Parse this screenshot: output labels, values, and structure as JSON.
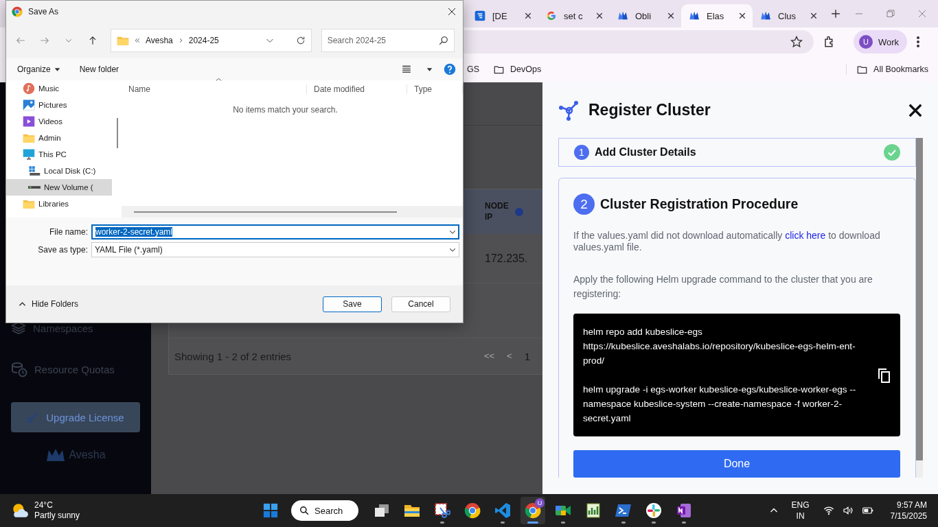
{
  "browser": {
    "tabs": [
      {
        "label": "[DE",
        "kind": "board",
        "selected": false
      },
      {
        "label": "set c",
        "kind": "g",
        "selected": false
      },
      {
        "label": "Obli",
        "kind": "crown",
        "selected": false
      },
      {
        "label": "Elas",
        "kind": "crown",
        "selected": true
      },
      {
        "label": "Clus",
        "kind": "crown",
        "selected": false
      }
    ],
    "profile": {
      "initial": "U",
      "label": "Work"
    },
    "bookmarks": [
      {
        "label": "GS",
        "kind": "plain"
      },
      {
        "label": "DevOps",
        "kind": "folder"
      }
    ],
    "all_bookmarks": "All Bookmarks"
  },
  "app": {
    "sidebar": [
      {
        "label": "Namespaces",
        "kind": "layers"
      },
      {
        "label": "Resource Quotas",
        "kind": "coins"
      }
    ],
    "upgrade_button": "Upgrade License",
    "logo": "Avesha",
    "table": {
      "columns": [
        "NODE IP"
      ],
      "cell": "172.235.",
      "footer": "Showing 1 - 2 of 2 entries",
      "pager": [
        "<<",
        "<",
        "1"
      ]
    }
  },
  "panel": {
    "title": "Register Cluster",
    "step_1": {
      "number": "1",
      "title": "Add Cluster Details",
      "completed": true
    },
    "step_2": {
      "number": "2",
      "title": "Cluster Registration Procedure",
      "intro_before": "If the values.yaml did not download automatically",
      "link": "click here",
      "intro_after": "to download values.yaml file.",
      "instruction": "Apply the following Helm upgrade command to the cluster that you are registering:",
      "commands": [
        "helm repo add kubeslice-egs https://kubeslice.aveshalabs.io/repository/kubeslice-egs-helm-ent-prod/",
        "helm upgrade -i egs-worker kubeslice-egs/kubeslice-worker-egs --namespace kubeslice-system --create-namespace -f worker-2-secret.yaml"
      ],
      "done_button": "Done"
    }
  },
  "dialog": {
    "title": "Save As",
    "path": [
      "Avesha",
      "2024-25"
    ],
    "search": {
      "placeholder": "Search 2024-25"
    },
    "organize": "Organize",
    "new_folder": "New folder",
    "nav": [
      {
        "label": "Music",
        "kind": "music",
        "selected": false
      },
      {
        "label": "Pictures",
        "kind": "pictures",
        "selected": false
      },
      {
        "label": "Videos",
        "kind": "videos",
        "selected": false
      },
      {
        "label": "Admin",
        "kind": "folder",
        "selected": false
      },
      {
        "label": "This PC",
        "kind": "pc",
        "selected": false,
        "children": [
          {
            "label": "Local Disk (C:)",
            "kind": "disk",
            "selected": false
          },
          {
            "label": "New Volume (",
            "kind": "drive",
            "selected": true
          }
        ]
      },
      {
        "label": "Libraries",
        "kind": "folder",
        "selected": false
      }
    ],
    "columns": [
      "Name",
      "Date modified",
      "Type"
    ],
    "empty_message": "No items match your search.",
    "file_name": {
      "label": "File name:",
      "value": "worker-2-secret.yaml"
    },
    "save_type": {
      "label": "Save as type:",
      "value": "YAML File (*.yaml)"
    },
    "hide_folders": "Hide Folders",
    "buttons": [
      "Save",
      "Cancel"
    ]
  },
  "taskbar": {
    "weather": {
      "temp": "24°C",
      "condition": "Partly sunny"
    },
    "search": "Search",
    "apps": [
      {
        "kind": "taskview",
        "running": false,
        "selected": false
      },
      {
        "kind": "explorer",
        "running": false,
        "selected": false
      },
      {
        "kind": "snip",
        "running": true,
        "selected": false
      },
      {
        "kind": "browser",
        "running": false,
        "selected": false
      },
      {
        "kind": "editor",
        "running": true,
        "selected": false
      },
      {
        "kind": "browser",
        "running": true,
        "selected": true,
        "badge": "U"
      },
      {
        "kind": "camera",
        "running": true,
        "selected": false
      },
      {
        "kind": "chart",
        "running": false,
        "selected": false
      },
      {
        "kind": "terminal",
        "running": true,
        "selected": false
      },
      {
        "kind": "pinwheel",
        "running": true,
        "selected": false
      },
      {
        "kind": "notebook",
        "running": true,
        "selected": false
      }
    ],
    "language": [
      "ENG",
      "IN"
    ],
    "time": "9:57 AM",
    "date": "7/15/2025"
  }
}
